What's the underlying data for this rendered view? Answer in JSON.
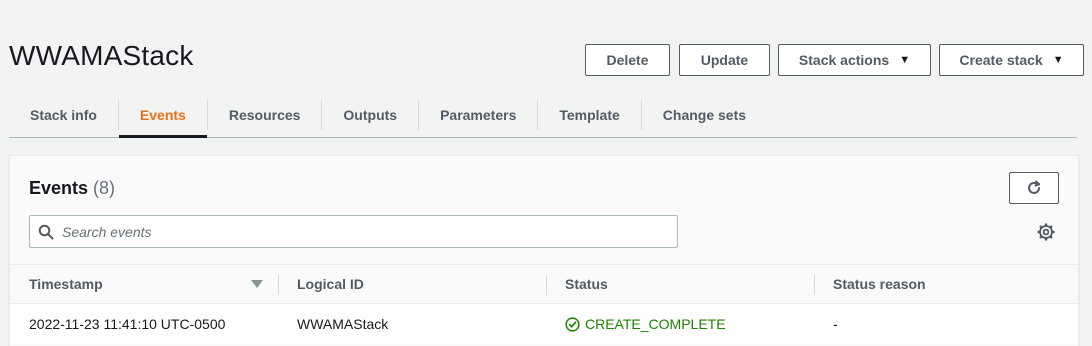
{
  "header": {
    "title": "WWAMAStack",
    "buttons": {
      "delete": "Delete",
      "update": "Update",
      "stack_actions": "Stack actions",
      "create_stack": "Create stack"
    }
  },
  "tabs": [
    {
      "label": "Stack info",
      "active": false
    },
    {
      "label": "Events",
      "active": true
    },
    {
      "label": "Resources",
      "active": false
    },
    {
      "label": "Outputs",
      "active": false
    },
    {
      "label": "Parameters",
      "active": false
    },
    {
      "label": "Template",
      "active": false
    },
    {
      "label": "Change sets",
      "active": false
    }
  ],
  "events": {
    "title": "Events",
    "count": "(8)",
    "search_placeholder": "Search events",
    "columns": [
      "Timestamp",
      "Logical ID",
      "Status",
      "Status reason"
    ],
    "rows": [
      {
        "timestamp": "2022-11-23 11:41:10 UTC-0500",
        "logical_id": "WWAMAStack",
        "status": "CREATE_COMPLETE",
        "status_reason": "-"
      }
    ]
  },
  "colors": {
    "active_tab": "#ec7211",
    "success": "#1d8102",
    "button_border": "#545b64"
  },
  "icons": [
    "caret-down-icon",
    "refresh-icon",
    "search-icon",
    "settings-gear-icon",
    "sort-down-icon",
    "success-check-icon"
  ]
}
